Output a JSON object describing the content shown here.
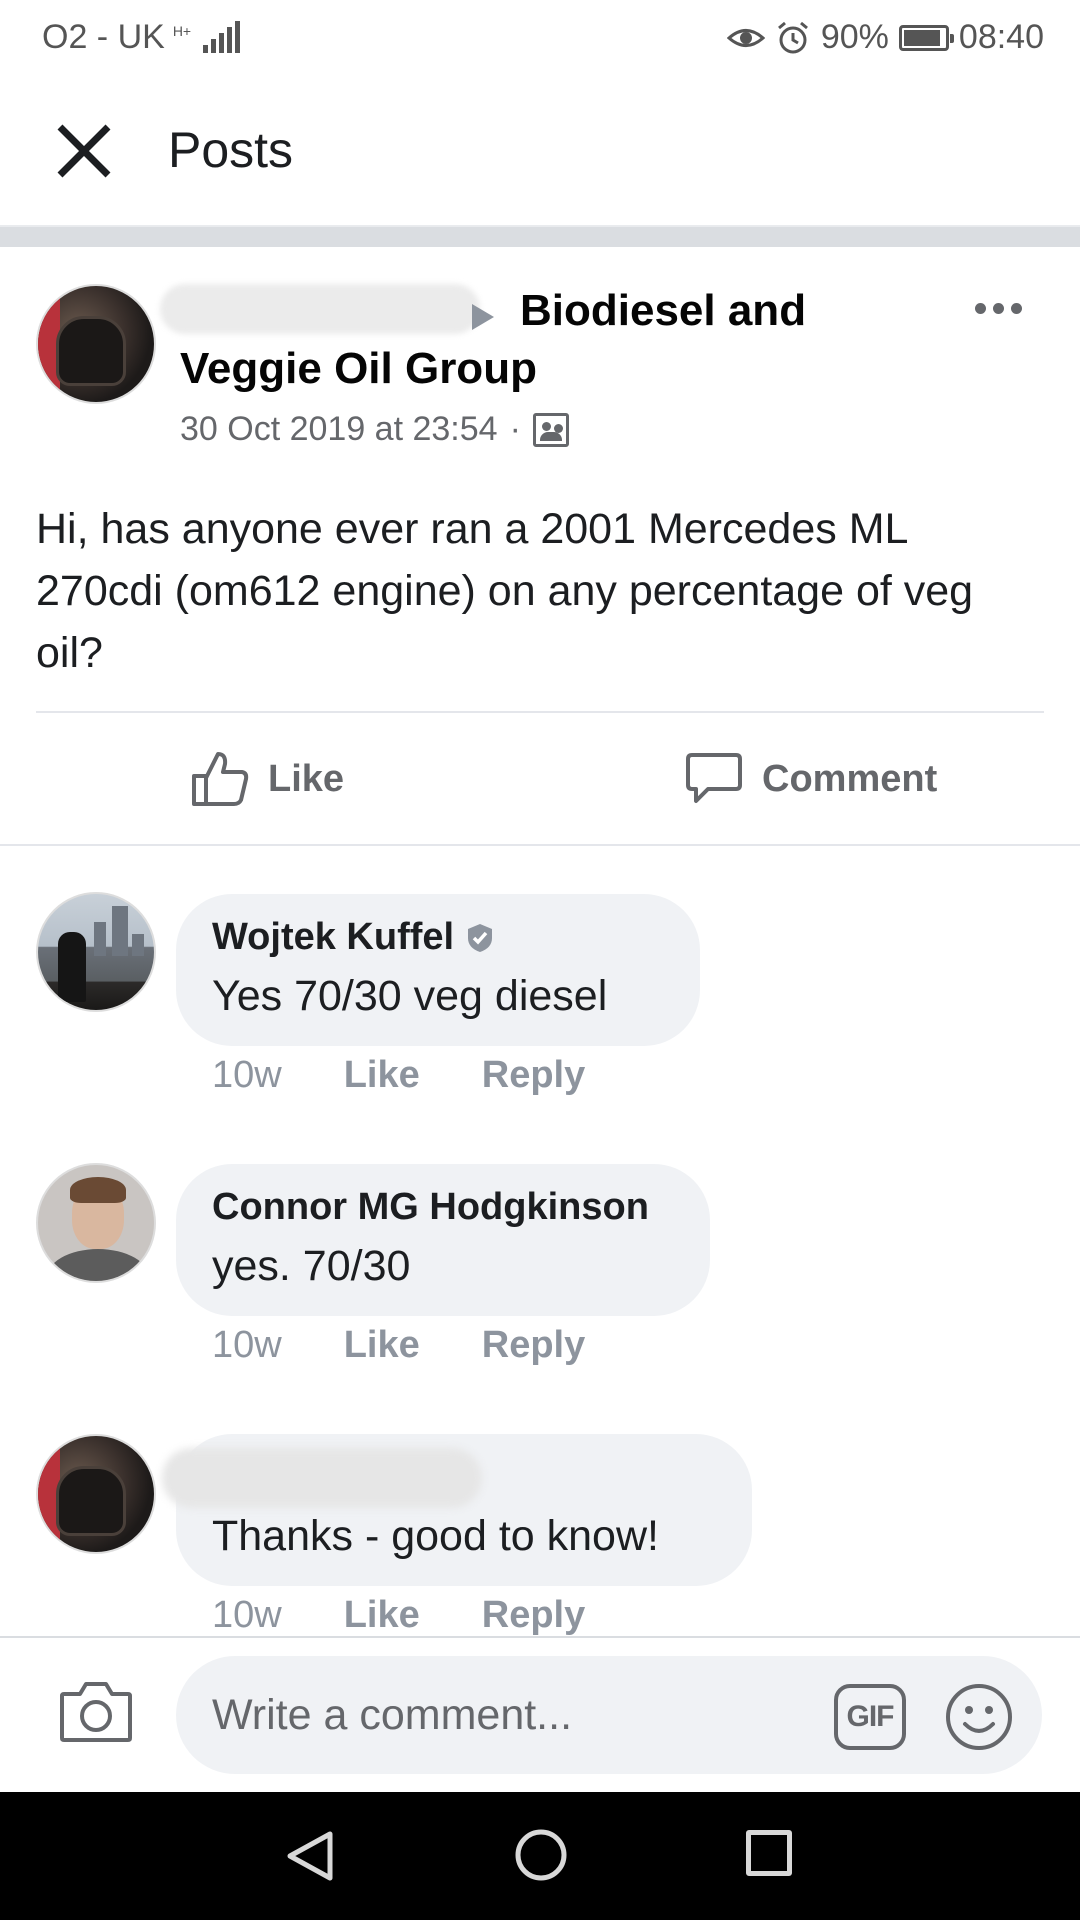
{
  "status_bar": {
    "carrier": "O2 - UK",
    "network": "H+",
    "battery": "90%",
    "battery_level": 0.9,
    "time": "08:40"
  },
  "header": {
    "title": "Posts"
  },
  "post": {
    "group_name": "Biodiesel and Veggie Oil Group",
    "timestamp": "30 Oct 2019 at 23:54",
    "separator": "·",
    "text": "Hi, has anyone ever ran a 2001 Mercedes ML 270cdi (om612 engine) on any percentage of veg oil?",
    "actions": {
      "like_label": "Like",
      "comment_label": "Comment"
    }
  },
  "comments": [
    {
      "name": "Wojtek Kuffel",
      "verified": true,
      "text": "Yes 70/30 veg diesel",
      "time": "10w",
      "like_label": "Like",
      "reply_label": "Reply"
    },
    {
      "name": "Connor MG Hodgkinson",
      "verified": false,
      "text": "yes. 70/30",
      "time": "10w",
      "like_label": "Like",
      "reply_label": "Reply"
    },
    {
      "name": "",
      "verified": false,
      "text": "Thanks - good to know!",
      "time": "10w",
      "like_label": "Like",
      "reply_label": "Reply"
    }
  ],
  "composer": {
    "placeholder": "Write a comment...",
    "gif_label": "GIF"
  },
  "icons": {
    "close": "close-icon",
    "more": "more-options-icon",
    "like": "thumbs-up-icon",
    "comment": "comment-bubble-icon",
    "camera": "camera-icon",
    "emoji": "emoji-icon",
    "group": "group-audience-icon",
    "verified": "verified-badge-icon"
  },
  "colors": {
    "secondary_text": "#65676b",
    "bubble_bg": "#f0f2f5",
    "divider": "#dadde1"
  }
}
